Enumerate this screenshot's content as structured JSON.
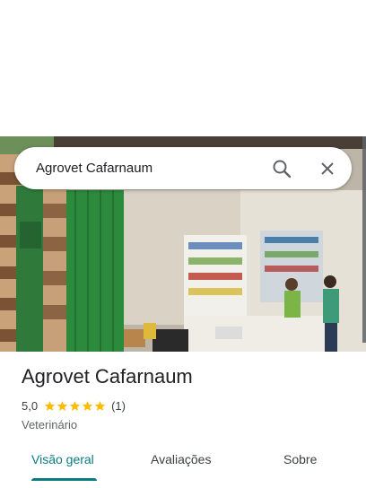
{
  "search": {
    "query": "Agrovet Cafarnaum"
  },
  "place": {
    "name": "Agrovet Cafarnaum",
    "rating": "5,0",
    "stars": 5,
    "reviews_count": "(1)",
    "category": "Veterinário"
  },
  "tabs": [
    {
      "label": "Visão geral",
      "active": true
    },
    {
      "label": "Avaliações",
      "active": false
    },
    {
      "label": "Sobre",
      "active": false
    }
  ],
  "colors": {
    "accent": "#0b7b80",
    "star": "#fbbc04"
  }
}
